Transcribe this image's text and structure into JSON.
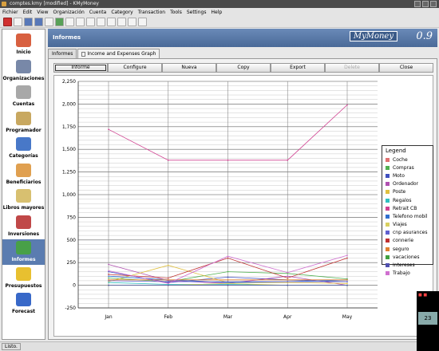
{
  "window": {
    "title": "comptes.kmy [modified] - KMyMoney"
  },
  "menu": [
    "Fichier",
    "Edit",
    "View",
    "Organización",
    "Cuenta",
    "Category",
    "Transaction",
    "Tools",
    "Settings",
    "Help"
  ],
  "sidebar": {
    "items": [
      {
        "label": "Inicio",
        "icon": "home-icon",
        "color": "#d86040"
      },
      {
        "label": "Organizaciones",
        "icon": "institution-icon",
        "color": "#7888a8"
      },
      {
        "label": "Cuentas",
        "icon": "bank-icon",
        "color": "#a8a8a8"
      },
      {
        "label": "Programador",
        "icon": "scheduler-icon",
        "color": "#c8a860"
      },
      {
        "label": "Categorías",
        "icon": "categories-icon",
        "color": "#4878c8"
      },
      {
        "label": "Beneficiarios",
        "icon": "payees-icon",
        "color": "#e0a050"
      },
      {
        "label": "Libros mayores",
        "icon": "ledger-icon",
        "color": "#d8c070"
      },
      {
        "label": "Inversiones",
        "icon": "investments-icon",
        "color": "#c04848"
      },
      {
        "label": "Informes",
        "icon": "reports-icon",
        "color": "#48a048"
      },
      {
        "label": "Presupuestos",
        "icon": "budget-icon",
        "color": "#e8c030"
      },
      {
        "label": "Forecast",
        "icon": "forecast-icon",
        "color": "#3868c8"
      }
    ],
    "active": "Informes"
  },
  "header": {
    "title": "Informes",
    "logo": "MyMoney",
    "version": "0.9"
  },
  "tabs": [
    {
      "label": "Informes"
    },
    {
      "label": "Income and Expenses Graph"
    }
  ],
  "buttons": {
    "informe": "Informe",
    "configure": "Configure",
    "nueva": "Nueva",
    "copy": "Copy",
    "export": "Export",
    "delete": "Delete",
    "close": "Close"
  },
  "chart_data": {
    "type": "line",
    "categories": [
      "Jan",
      "Feb",
      "Mar",
      "Apr",
      "May"
    ],
    "ylim": [
      -250,
      2250
    ],
    "yticks": [
      "2,250",
      "2,000",
      "1,750",
      "1,500",
      "1,250",
      "1,000",
      "750",
      "500",
      "250",
      "0",
      "-250"
    ],
    "legend_title": "Legend",
    "series": [
      {
        "name": "Coche",
        "color": "#e07070",
        "values": [
          0,
          0,
          0,
          0,
          0
        ]
      },
      {
        "name": "Compras",
        "color": "#50b050",
        "values": [
          80,
          40,
          150,
          130,
          70
        ]
      },
      {
        "name": "Moto",
        "color": "#4050c0",
        "values": [
          150,
          30,
          90,
          60,
          40
        ]
      },
      {
        "name": "Ordenador",
        "color": "#b050b0",
        "values": [
          230,
          50,
          20,
          100,
          0
        ]
      },
      {
        "name": "Poste",
        "color": "#e0c040",
        "values": [
          40,
          220,
          30,
          30,
          20
        ]
      },
      {
        "name": "Regalos",
        "color": "#30c0c0",
        "values": [
          30,
          10,
          10,
          0,
          0
        ]
      },
      {
        "name": "Retrait CB",
        "color": "#d04090",
        "values": [
          1720,
          1380,
          1380,
          1380,
          1990
        ]
      },
      {
        "name": "Telefono mobil",
        "color": "#3070d0",
        "values": [
          100,
          60,
          30,
          40,
          60
        ]
      },
      {
        "name": "Viajes",
        "color": "#d8d060",
        "values": [
          0,
          0,
          20,
          0,
          0
        ]
      },
      {
        "name": "cnp asurances",
        "color": "#6060d0",
        "values": [
          50,
          40,
          40,
          40,
          40
        ]
      },
      {
        "name": "connerie",
        "color": "#c03030",
        "values": [
          120,
          80,
          300,
          80,
          300
        ]
      },
      {
        "name": "seguro",
        "color": "#e08030",
        "values": [
          60,
          60,
          60,
          60,
          60
        ]
      },
      {
        "name": "vacaciones",
        "color": "#40a040",
        "values": [
          0,
          0,
          0,
          0,
          0
        ]
      },
      {
        "name": "Intereses",
        "color": "#5050b0",
        "values": [
          0,
          0,
          0,
          0,
          0
        ]
      },
      {
        "name": "Trabajo",
        "color": "#d070d0",
        "values": [
          160,
          20,
          320,
          140,
          330
        ]
      }
    ]
  },
  "statusbar": {
    "text": "Listo."
  },
  "tray": {
    "clock": "23"
  }
}
